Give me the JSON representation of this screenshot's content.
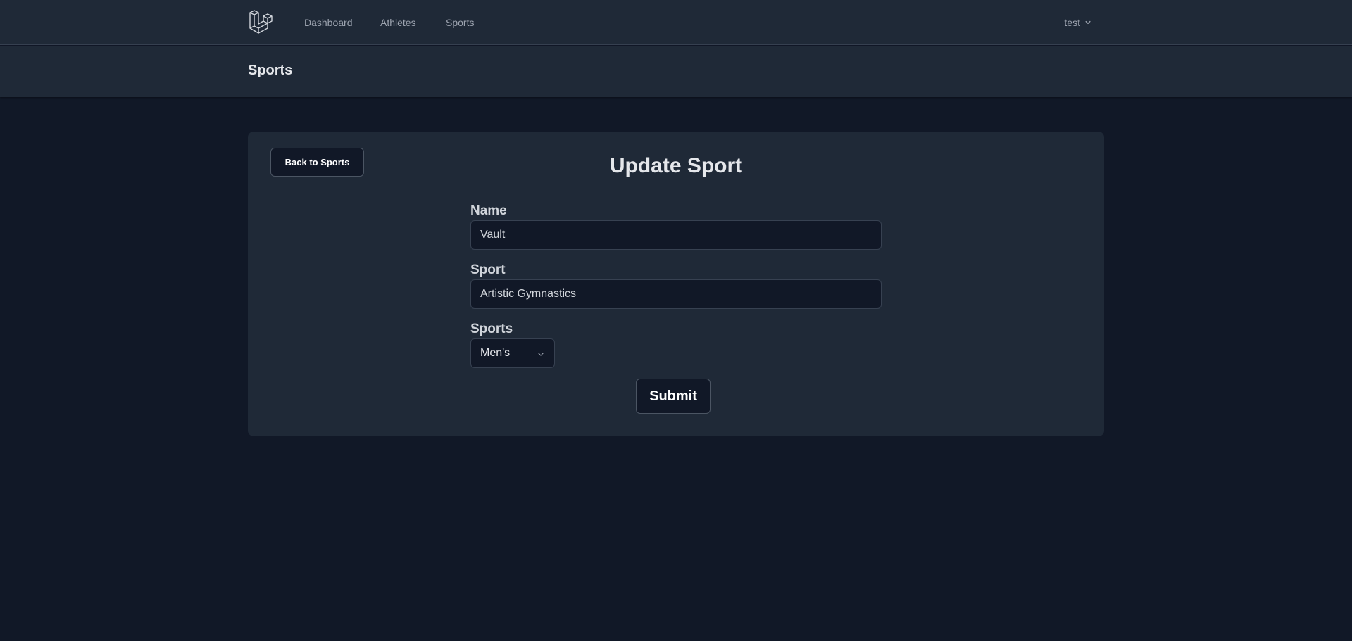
{
  "nav": {
    "logo_icon": "laravel-logo-icon",
    "links": [
      "Dashboard",
      "Athletes",
      "Sports"
    ],
    "user": "test",
    "user_menu_icon": "chevron-down-icon"
  },
  "header": {
    "title": "Sports"
  },
  "card": {
    "back_label": "Back to Sports",
    "title": "Update Sport",
    "fields": {
      "name": {
        "label": "Name",
        "value": "Vault"
      },
      "sport": {
        "label": "Sport",
        "value": "Artistic Gymnastics"
      },
      "sports": {
        "label": "Sports",
        "selected": "Men's"
      }
    },
    "submit_label": "Submit"
  },
  "colors": {
    "background": "#111827",
    "surface": "#1f2937",
    "border": "#374151",
    "text": "#e5e7eb",
    "muted_text": "#9ca3af"
  }
}
